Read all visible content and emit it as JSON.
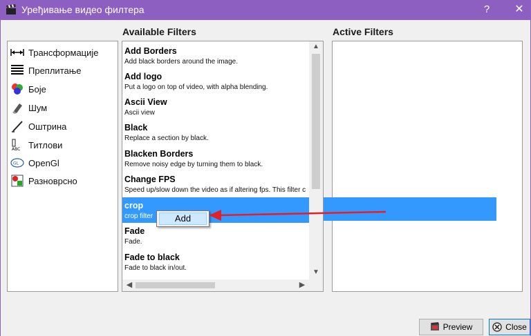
{
  "window": {
    "title": "Уређивање видео филтера",
    "help_label": "?",
    "close_label": "✕",
    "accent_color": "#8c5fc1"
  },
  "headings": {
    "available": "Available Filters",
    "active": "Active Filters"
  },
  "categories": [
    {
      "label": "Трансформације",
      "icon": "transform-icon"
    },
    {
      "label": "Преплитање",
      "icon": "interlace-icon"
    },
    {
      "label": "Боје",
      "icon": "colors-icon"
    },
    {
      "label": "Шум",
      "icon": "noise-icon"
    },
    {
      "label": "Оштрина",
      "icon": "sharpness-icon"
    },
    {
      "label": "Титлови",
      "icon": "subtitles-icon"
    },
    {
      "label": "OpenGl",
      "icon": "opengl-icon"
    },
    {
      "label": "Разноврсно",
      "icon": "misc-icon"
    }
  ],
  "filters": [
    {
      "name": "Add Borders",
      "desc": "Add black borders around the image."
    },
    {
      "name": "Add logo",
      "desc": "Put a logo on top of video, with alpha blending."
    },
    {
      "name": "Ascii View",
      "desc": "Ascii view"
    },
    {
      "name": "Black",
      "desc": "Replace a section by black."
    },
    {
      "name": "Blacken Borders",
      "desc": "Remove noisy edge by turning them to black."
    },
    {
      "name": "Change FPS",
      "desc": "Speed up/slow down the video as if altering fps. This filter c"
    },
    {
      "name": "crop",
      "desc": "crop filter",
      "selected": true
    },
    {
      "name": "Fade",
      "desc": "Fade."
    },
    {
      "name": "Fade to black",
      "desc": "Fade to black in/out."
    }
  ],
  "context_menu": {
    "add_label": "Add"
  },
  "buttons": {
    "preview": "Preview",
    "close": "Close"
  },
  "colors": {
    "selection": "#3399ff",
    "arrow": "#e0202a"
  }
}
